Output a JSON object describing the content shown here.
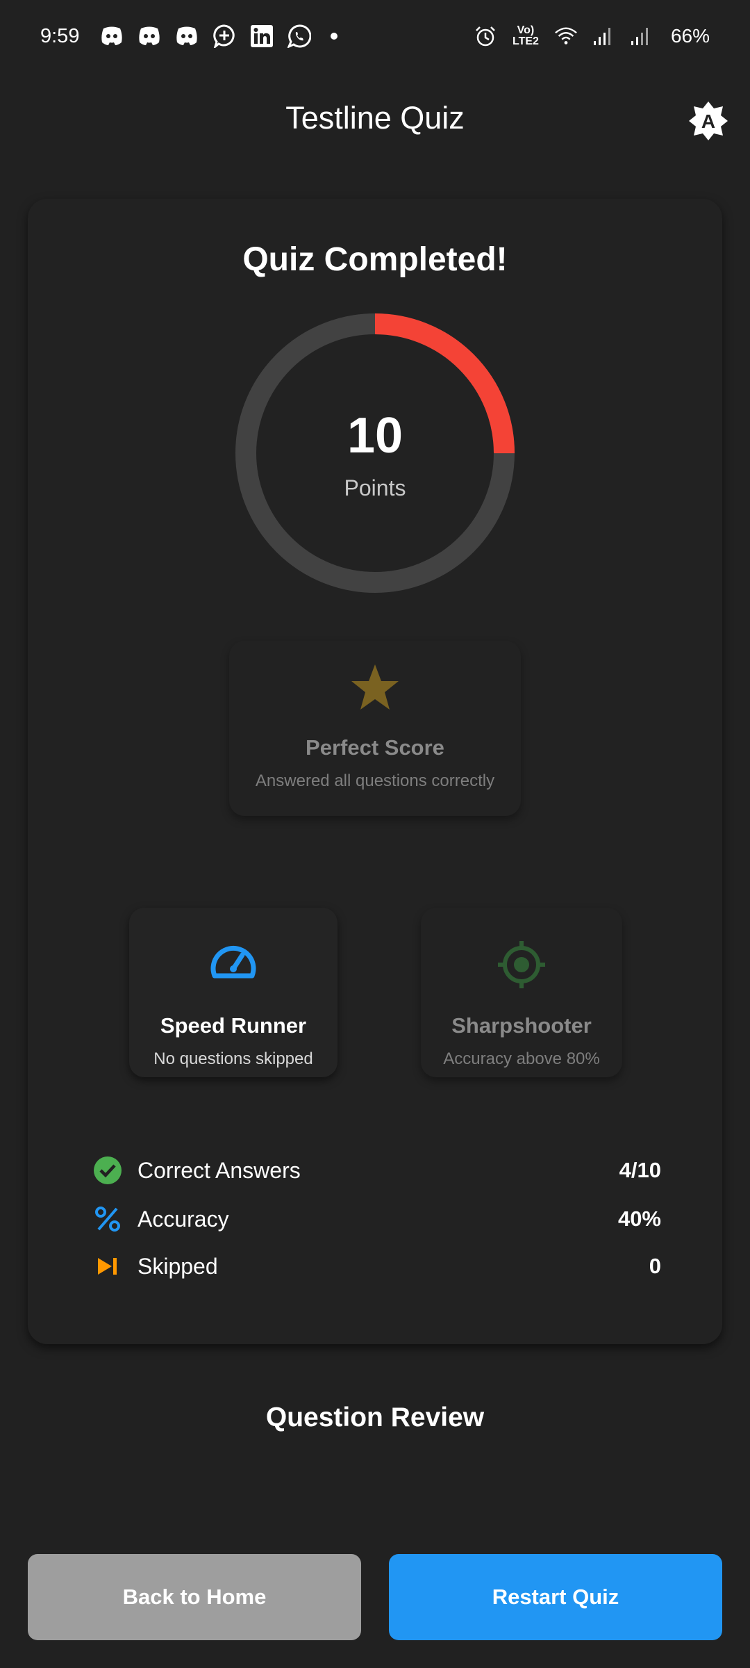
{
  "status_bar": {
    "time": "9:59",
    "network_label": "Vo) LTE2",
    "battery": "66%",
    "icons": [
      "discord-icon",
      "discord-icon",
      "discord-icon",
      "chat-plus-icon",
      "linkedin-icon",
      "whatsapp-icon",
      "dot",
      "alarm-icon",
      "volte-icon",
      "wifi-icon",
      "signal-icon",
      "signal-icon"
    ]
  },
  "app_bar": {
    "title": "Testline Quiz",
    "theme_icon": "brightness-auto-icon"
  },
  "result": {
    "heading": "Quiz Completed!",
    "score": "10",
    "score_unit": "Points",
    "ring_fill_fraction": 0.25,
    "ring_color": "#f44336",
    "ring_track_color": "#424242"
  },
  "badges": {
    "perfect": {
      "title": "Perfect Score",
      "desc": "Answered all questions correctly",
      "icon": "star-icon",
      "color": "#7a6221",
      "earned": false
    },
    "speed": {
      "title": "Speed Runner",
      "desc": "No questions skipped",
      "icon": "speedometer-icon",
      "color": "#2196f3",
      "earned": true
    },
    "sharp": {
      "title": "Sharpshooter",
      "desc": "Accuracy above 80%",
      "icon": "crosshair-icon",
      "color": "#2e5c32",
      "earned": false
    }
  },
  "stats": {
    "correct": {
      "label": "Correct Answers",
      "value": "4/10",
      "icon": "check-circle-icon",
      "color": "#4caf50"
    },
    "accuracy": {
      "label": "Accuracy",
      "value": "40%",
      "icon": "percent-icon",
      "color": "#2196f3"
    },
    "skipped": {
      "label": "Skipped",
      "value": "0",
      "icon": "skip-next-icon",
      "color": "#ff9800"
    }
  },
  "review": {
    "title": "Question Review"
  },
  "actions": {
    "home_label": "Back to Home",
    "restart_label": "Restart Quiz"
  }
}
